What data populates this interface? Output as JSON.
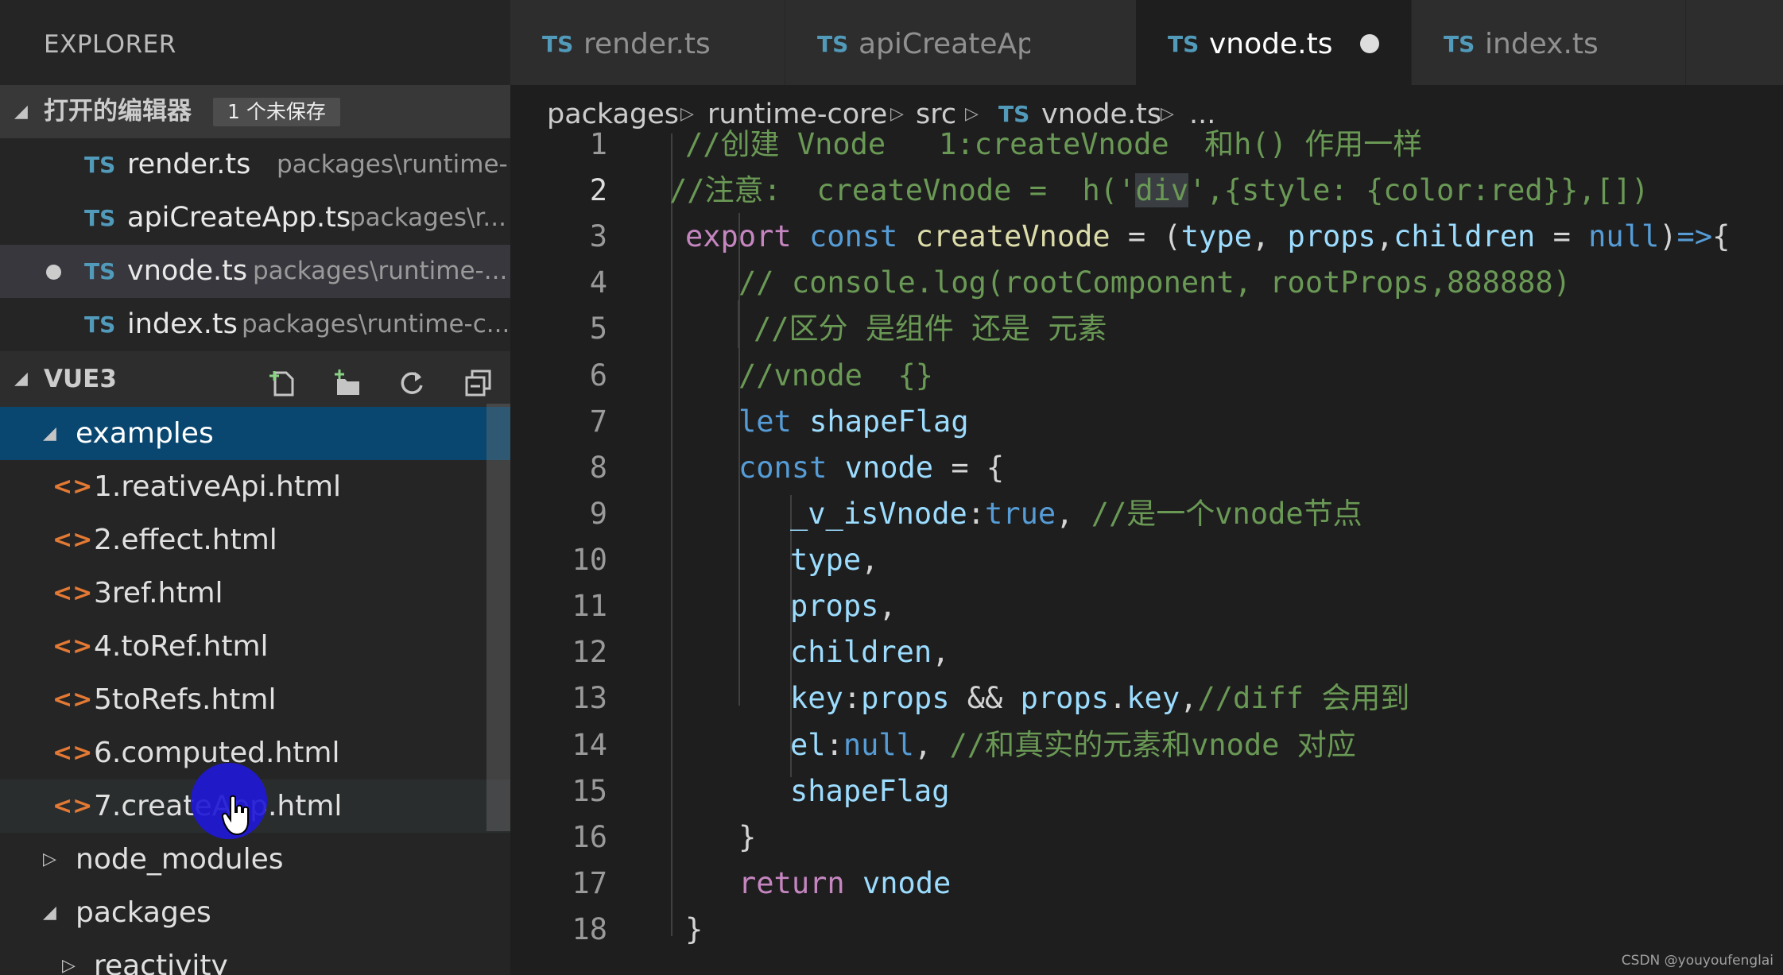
{
  "sidebar": {
    "title": "EXPLORER",
    "open_editors": {
      "label": "打开的编辑器",
      "badge": "1 个未保存",
      "items": [
        {
          "icon": "TS",
          "name": "render.ts",
          "path": "packages\\runtime-..."
        },
        {
          "icon": "TS",
          "name": "apiCreateApp.ts",
          "path": "packages\\r..."
        },
        {
          "icon": "TS",
          "name": "vnode.ts",
          "path": "packages\\runtime-...",
          "unsaved": true
        },
        {
          "icon": "TS",
          "name": "index.ts",
          "path": "packages\\runtime-c..."
        }
      ]
    },
    "workspace": {
      "label": "VUE3",
      "buttons": [
        "new-file-icon",
        "new-folder-icon",
        "refresh-icon",
        "collapse-all-icon"
      ],
      "tree": [
        {
          "name": "examples",
          "type": "folder",
          "expanded": true,
          "selected": true
        },
        {
          "name": "1.reativeApi.html",
          "type": "html"
        },
        {
          "name": "2.effect.html",
          "type": "html"
        },
        {
          "name": "3ref.html",
          "type": "html"
        },
        {
          "name": "4.toRef.html",
          "type": "html"
        },
        {
          "name": "5toRefs.html",
          "type": "html"
        },
        {
          "name": "6.computed.html",
          "type": "html"
        },
        {
          "name": "7.createApp.html",
          "type": "html",
          "hovered": true
        },
        {
          "name": "node_modules",
          "type": "folder",
          "expanded": false
        },
        {
          "name": "packages",
          "type": "folder",
          "expanded": true
        },
        {
          "name": "reactivity",
          "type": "folder",
          "expanded": false
        }
      ]
    }
  },
  "tabs": [
    {
      "icon": "TS",
      "label": "render.ts"
    },
    {
      "icon": "TS",
      "label": "apiCreateApp.ts"
    },
    {
      "icon": "TS",
      "label": "vnode.ts",
      "active": true,
      "unsaved": true
    },
    {
      "icon": "TS",
      "label": "index.ts"
    }
  ],
  "breadcrumb": [
    "packages",
    "runtime-core",
    "src",
    "vnode.ts",
    "..."
  ],
  "breadcrumb_file_icon": "TS",
  "editor": {
    "current_line": 2,
    "lines": [
      {
        "n": "1",
        "tokens": [
          [
            "cm",
            "//创建 Vnode   1:createVnode  和h() 作用一样"
          ]
        ]
      },
      {
        "n": "2",
        "tokens": [
          [
            "cm",
            "//注意:  createVnode =  h('"
          ],
          [
            "cm hl",
            "div"
          ],
          [
            "cm",
            "',{style: {color:red}},[])"
          ]
        ]
      },
      {
        "n": "3",
        "tokens": [
          [
            "kw",
            "export"
          ],
          [
            "pn",
            " "
          ],
          [
            "st",
            "const"
          ],
          [
            "pn",
            " "
          ],
          [
            "fn",
            "createVnode"
          ],
          [
            "pn",
            " = ("
          ],
          [
            "vr",
            "type"
          ],
          [
            "pn",
            ", "
          ],
          [
            "vr",
            "props"
          ],
          [
            "pn",
            ","
          ],
          [
            "vr",
            "children"
          ],
          [
            "pn",
            " = "
          ],
          [
            "st",
            "null"
          ],
          [
            "pn",
            ")"
          ],
          [
            "st",
            "=>"
          ],
          [
            "pn",
            "{"
          ]
        ]
      },
      {
        "n": "4",
        "tokens": [
          [
            "cm",
            "// console.log(rootComponent, rootProps,888888)"
          ]
        ]
      },
      {
        "n": "5",
        "tokens": [
          [
            "cm",
            "//区分 是组件 还是 元素"
          ]
        ]
      },
      {
        "n": "6",
        "tokens": [
          [
            "cm",
            "//vnode  {}"
          ]
        ]
      },
      {
        "n": "7",
        "tokens": [
          [
            "st",
            "let"
          ],
          [
            "pn",
            " "
          ],
          [
            "vr",
            "shapeFlag"
          ]
        ]
      },
      {
        "n": "8",
        "tokens": [
          [
            "st",
            "const"
          ],
          [
            "pn",
            " "
          ],
          [
            "vr",
            "vnode"
          ],
          [
            "pn",
            " = {"
          ]
        ]
      },
      {
        "n": "9",
        "tokens": [
          [
            "vr",
            "_v_isVnode"
          ],
          [
            "pn",
            ":"
          ],
          [
            "st",
            "true"
          ],
          [
            "pn",
            ", "
          ],
          [
            "cm",
            "//是一个vnode节点"
          ]
        ]
      },
      {
        "n": "10",
        "tokens": [
          [
            "vr",
            "type"
          ],
          [
            "pn",
            ","
          ]
        ]
      },
      {
        "n": "11",
        "tokens": [
          [
            "vr",
            "props"
          ],
          [
            "pn",
            ","
          ]
        ]
      },
      {
        "n": "12",
        "tokens": [
          [
            "vr",
            "children"
          ],
          [
            "pn",
            ","
          ]
        ]
      },
      {
        "n": "13",
        "tokens": [
          [
            "vr",
            "key"
          ],
          [
            "pn",
            ":"
          ],
          [
            "vr",
            "props"
          ],
          [
            "pn",
            " && "
          ],
          [
            "vr",
            "props"
          ],
          [
            "pn",
            "."
          ],
          [
            "vr",
            "key"
          ],
          [
            "pn",
            ","
          ],
          [
            "cm",
            "//diff 会用到"
          ]
        ]
      },
      {
        "n": "14",
        "tokens": [
          [
            "vr",
            "el"
          ],
          [
            "pn",
            ":"
          ],
          [
            "st",
            "null"
          ],
          [
            "pn",
            ", "
          ],
          [
            "cm",
            "//和真实的元素和vnode 对应"
          ]
        ]
      },
      {
        "n": "15",
        "tokens": [
          [
            "vr",
            "shapeFlag"
          ]
        ]
      },
      {
        "n": "16",
        "tokens": [
          [
            "pn",
            "}"
          ]
        ]
      },
      {
        "n": "17",
        "tokens": [
          [
            "kw",
            "return"
          ],
          [
            "pn",
            " "
          ],
          [
            "vr",
            "vnode"
          ]
        ]
      },
      {
        "n": "18",
        "tokens": [
          [
            "pn",
            "}"
          ]
        ]
      }
    ]
  },
  "watermark": "CSDN @youyoufenglai"
}
